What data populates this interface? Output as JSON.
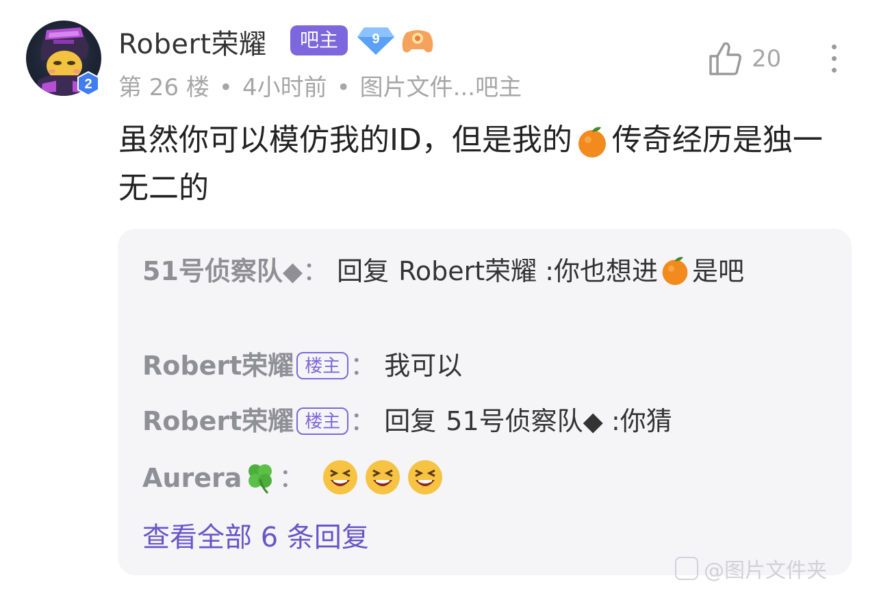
{
  "post": {
    "username": "Robert荣耀",
    "role_badge": "吧主",
    "level": "9",
    "avatar_level": "2",
    "floor": "第 26 楼",
    "time": "4小时前",
    "source": "图片文件...吧主",
    "meta_sep": "•",
    "like_count": "20",
    "body_part1": "虽然你可以模仿我的ID，但是我的",
    "body_part2": "传奇经历是独一无二的"
  },
  "replies": [
    {
      "author": "51号侦察队◆",
      "colon": "：",
      "reply_kw": "回复",
      "target": "Robert荣耀",
      "text_part1": ":你也想进",
      "text_part2": "是吧"
    },
    {
      "author": "Robert荣耀",
      "badge": "楼主",
      "colon": "：",
      "text": "我可以"
    },
    {
      "author": "Robert荣耀",
      "badge": "楼主",
      "colon": "：",
      "reply_kw": "回复",
      "target": "51号侦察队◆",
      "text": ":你猜"
    },
    {
      "author": "Aurera",
      "colon": "：",
      "emoji": "grinning-squint-emoji x3"
    }
  ],
  "view_all": "查看全部 6 条回复",
  "watermark": "@图片文件夹",
  "colors": {
    "accent_purple": "#7d67dc",
    "link_purple": "#6955c9",
    "reply_bg": "#f5f5f8",
    "meta_gray": "#a6a6a6"
  }
}
